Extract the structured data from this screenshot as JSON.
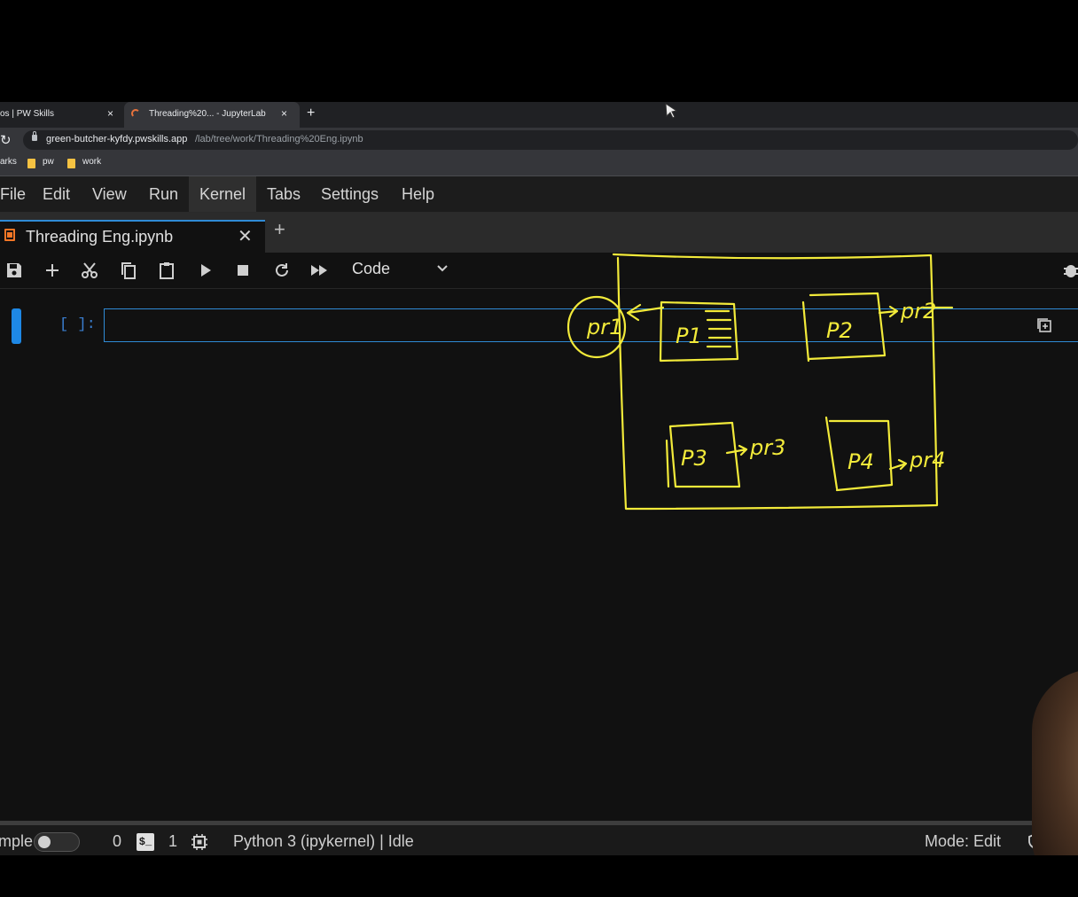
{
  "browser": {
    "tabs": [
      {
        "label": "os | PW Skills",
        "close": "×"
      },
      {
        "label": "Threading%20... - JupyterLab",
        "close": "×"
      }
    ],
    "new_tab": "+",
    "url_host": "green-butcher-kyfdy.pwskills.app",
    "url_path": "/lab/tree/work/Threading%20Eng.ipynb",
    "bookmarks": [
      "arks",
      "pw",
      "work"
    ]
  },
  "menubar": {
    "items": [
      "File",
      "Edit",
      "View",
      "Run",
      "Kernel",
      "Tabs",
      "Settings",
      "Help"
    ],
    "active": "Kernel"
  },
  "document_tab": {
    "title": "Threading Eng.ipynb",
    "close": "✕",
    "add": "+"
  },
  "toolbar": {
    "icons": [
      "save-icon",
      "add-cell-icon",
      "cut-icon",
      "copy-icon",
      "paste-icon",
      "run-icon",
      "stop-icon",
      "restart-icon",
      "fast-forward-icon"
    ],
    "cell_type": "Code"
  },
  "cell": {
    "prompt": "[ ]:",
    "content": ""
  },
  "annotation": {
    "color": "#f2ea3a",
    "labels": [
      "pr1",
      "P1",
      "P2",
      "pr2",
      "P3",
      "pr3",
      "P4",
      "pr4"
    ]
  },
  "statusbar": {
    "mode_label": "mple",
    "terminals": "0",
    "terminal_icon": "$_",
    "kernels": "1",
    "kernel_status": "Python 3 (ipykernel) | Idle",
    "mode": "Mode: Edit"
  },
  "colors": {
    "accent": "#2f8bd6",
    "cell_bar": "#1e88e5",
    "notebook_icon": "#f37626",
    "background": "#111111"
  }
}
